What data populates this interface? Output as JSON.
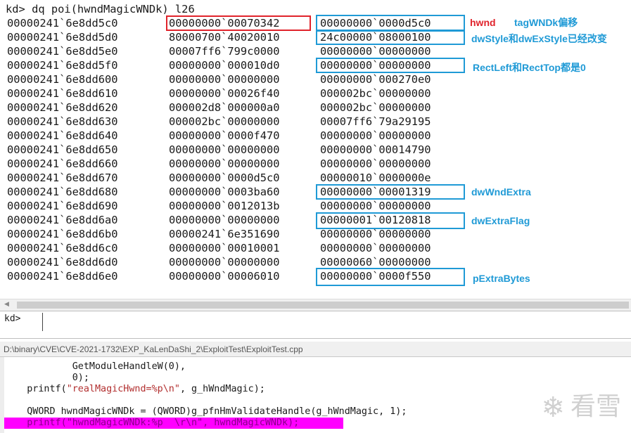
{
  "command": {
    "line": "kd> dq poi(hwndMagicWNDk) l26",
    "rows": [
      {
        "addr": "00000241`6e8dd5c0",
        "q1": "00000000`00070342",
        "q2": "00000000`0000d5c0"
      },
      {
        "addr": "00000241`6e8dd5d0",
        "q1": "80000700`40020010",
        "q2": "24c00000`08000100"
      },
      {
        "addr": "00000241`6e8dd5e0",
        "q1": "00007ff6`799c0000",
        "q2": "00000000`00000000"
      },
      {
        "addr": "00000241`6e8dd5f0",
        "q1": "00000000`000010d0",
        "q2": "00000000`00000000"
      },
      {
        "addr": "00000241`6e8dd600",
        "q1": "00000000`00000000",
        "q2": "00000000`000270e0"
      },
      {
        "addr": "00000241`6e8dd610",
        "q1": "00000000`00026f40",
        "q2": "000002bc`00000000"
      },
      {
        "addr": "00000241`6e8dd620",
        "q1": "000002d8`000000a0",
        "q2": "000002bc`00000000"
      },
      {
        "addr": "00000241`6e8dd630",
        "q1": "000002bc`00000000",
        "q2": "00007ff6`79a29195"
      },
      {
        "addr": "00000241`6e8dd640",
        "q1": "00000000`0000f470",
        "q2": "00000000`00000000"
      },
      {
        "addr": "00000241`6e8dd650",
        "q1": "00000000`00000000",
        "q2": "00000000`00014790"
      },
      {
        "addr": "00000241`6e8dd660",
        "q1": "00000000`00000000",
        "q2": "00000000`00000000"
      },
      {
        "addr": "00000241`6e8dd670",
        "q1": "00000000`0000d5c0",
        "q2": "00000010`0000000e"
      },
      {
        "addr": "00000241`6e8dd680",
        "q1": "00000000`0003ba60",
        "q2": "00000000`00001319"
      },
      {
        "addr": "00000241`6e8dd690",
        "q1": "00000000`0012013b",
        "q2": "00000000`00000000"
      },
      {
        "addr": "00000241`6e8dd6a0",
        "q1": "00000000`00000000",
        "q2": "00000001`00120818"
      },
      {
        "addr": "00000241`6e8dd6b0",
        "q1": "00000241`6e351690",
        "q2": "00000000`00000000"
      },
      {
        "addr": "00000241`6e8dd6c0",
        "q1": "00000000`00010001",
        "q2": "00000000`00000000"
      },
      {
        "addr": "00000241`6e8dd6d0",
        "q1": "00000000`00000000",
        "q2": "00000060`00000000"
      },
      {
        "addr": "00000241`6e8dd6e0",
        "q1": "00000000`00006010",
        "q2": "00000000`0000f550"
      }
    ]
  },
  "annotations": {
    "hwnd": "hwnd",
    "tag_offset": "tagWNDk偏移",
    "style": "dwStyle和dwExStyle已经改变",
    "rect": "RectLeft和RectTop都是0",
    "wnd_extra": "dwWndExtra",
    "extra_flag": "dwExtraFlag",
    "extra_bytes": "pExtraBytes"
  },
  "colors": {
    "annotation_blue": "#1f9ad6",
    "annotation_red": "#e0232b",
    "highlight_magenta": "#ff00ff"
  },
  "input": {
    "prompt": "kd>"
  },
  "source": {
    "path": "D:\\binary\\CVE\\CVE-2021-1732\\EXP_KaLenDaShi_2\\ExploitTest\\ExploitTest.cpp",
    "l1": "            GetModuleHandleW(0),",
    "l2": "            0);",
    "l3_pre": "    printf(",
    "l3_str": "\"realMagicHwnd=%p\\n\"",
    "l3_post": ", g_hWndMagic);",
    "l4": "",
    "l5": "    QWORD hwndMagicWNDk = (QWORD)g_pfnHmValidateHandle(g_hWndMagic, 1);",
    "l6_pre": "    printf(",
    "l6_str": "\"hwndMagicWNDk:%p  \\r\\n\"",
    "l6_post": ", hwndMagicWNDk);"
  },
  "watermark": {
    "icon": "snowflake-icon",
    "text": "看雪"
  }
}
